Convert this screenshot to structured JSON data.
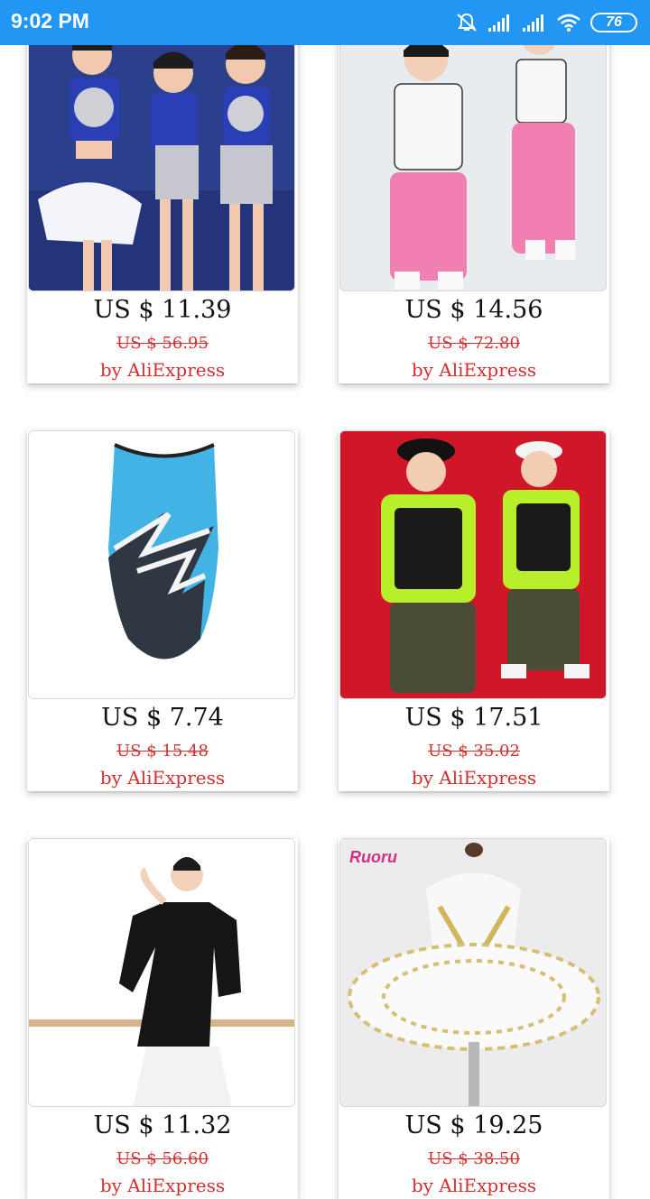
{
  "status": {
    "time": "9:02 PM",
    "battery": "76",
    "icons": [
      "mute-icon",
      "signal-icon",
      "signal-icon",
      "wifi-icon",
      "battery-icon"
    ]
  },
  "products": [
    {
      "price": "US $ 11.39",
      "original_price": "US $ 56.95",
      "seller": "by AliExpress",
      "image": "sequin-dance-costume-photo"
    },
    {
      "price": "US $ 14.56",
      "original_price": "US $ 72.80",
      "seller": "by AliExpress",
      "image": "white-top-pink-joggers-photo"
    },
    {
      "price": "US $ 7.74",
      "original_price": "US $ 15.48",
      "seller": "by AliExpress",
      "image": "blue-gymnastics-leotard-photo"
    },
    {
      "price": "US $ 17.51",
      "original_price": "US $ 35.02",
      "seller": "by AliExpress",
      "image": "hiphop-green-vest-kids-photo"
    },
    {
      "price": "US $ 11.32",
      "original_price": "US $ 56.60",
      "seller": "by AliExpress",
      "image": "black-dance-top-photo"
    },
    {
      "price": "US $ 19.25",
      "original_price": "US $ 38.50",
      "seller": "by AliExpress",
      "image": "white-gold-ballet-tutu-photo",
      "brand": "Ruoru"
    }
  ]
}
